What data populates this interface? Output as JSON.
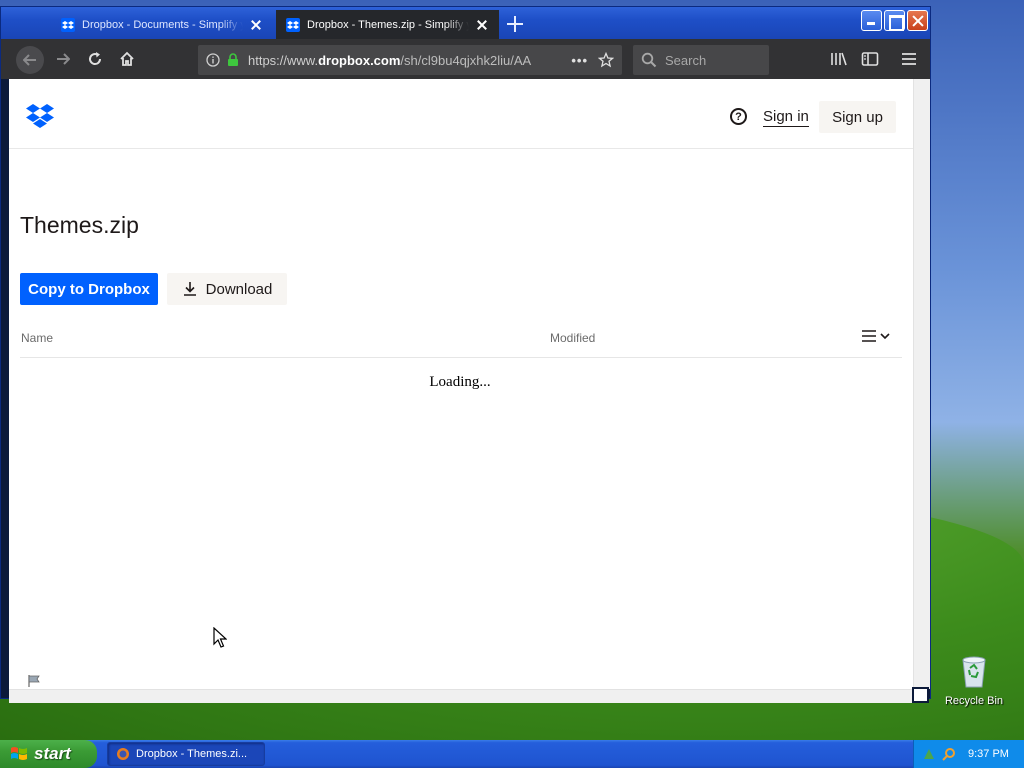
{
  "browser": {
    "tabs": [
      {
        "title": "Dropbox - Documents - Simplify y",
        "active": false
      },
      {
        "title": "Dropbox - Themes.zip - Simplify y",
        "active": true
      }
    ],
    "url_prefix": "https://www.",
    "url_domain": "dropbox.com",
    "url_path": "/sh/cl9bu4qjxhk2liu/AA",
    "search_placeholder": "Search"
  },
  "header": {
    "sign_in": "Sign in",
    "sign_up": "Sign up",
    "help_glyph": "?"
  },
  "file": {
    "name": "Themes.zip",
    "copy_button": "Copy to Dropbox",
    "download_button": "Download"
  },
  "table": {
    "columns": [
      "Name",
      "Modified"
    ],
    "loading_text": "Loading..."
  },
  "desktop": {
    "recycle_bin_label": "Recycle Bin"
  },
  "taskbar": {
    "start_label": "start",
    "task_item": "Dropbox - Themes.zi...",
    "clock": "9:37 PM"
  },
  "colors": {
    "dropbox_blue": "#0061fe",
    "toolbar": "#323234",
    "taskbar": "#245edb"
  }
}
